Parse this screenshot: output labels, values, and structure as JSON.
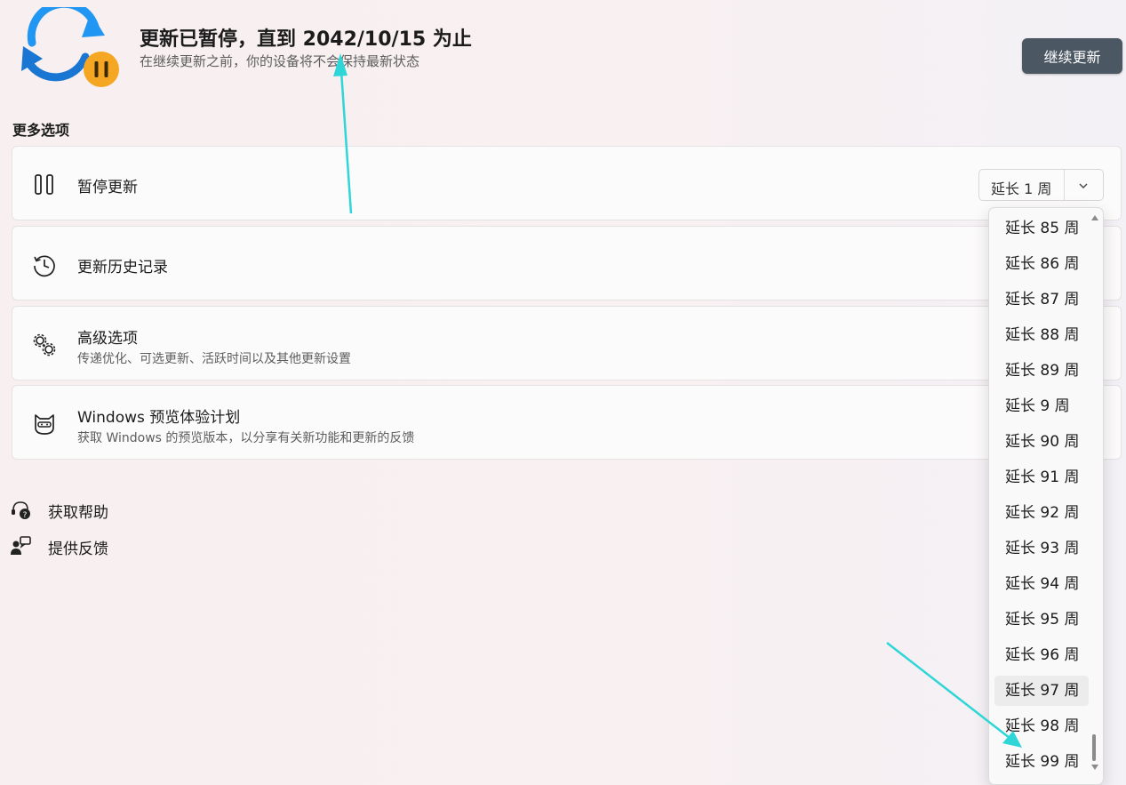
{
  "header": {
    "status_title": "更新已暂停，直到 2042/10/15 为止",
    "status_subtitle": "在继续更新之前，你的设备将不会保持最新状态",
    "resume_button": "继续更新",
    "icon": "sync-paused-icon"
  },
  "more_options": {
    "section_title": "更多选项",
    "pause": {
      "title": "暂停更新",
      "selected": "延长 1 周",
      "icon": "pause-icon"
    },
    "history": {
      "title": "更新历史记录",
      "icon": "history-icon"
    },
    "advanced": {
      "title": "高级选项",
      "desc": "传递优化、可选更新、活跃时间以及其他更新设置",
      "icon": "gears-icon"
    },
    "insider": {
      "title": "Windows 预览体验计划",
      "desc": "获取 Windows 的预览版本，以分享有关新功能和更新的反馈",
      "icon": "ninja-cat-icon"
    }
  },
  "links": {
    "help": "获取帮助",
    "feedback": "提供反馈"
  },
  "dropdown": {
    "options": [
      "延长 85 周",
      "延长 86 周",
      "延长 87 周",
      "延长 88 周",
      "延长 89 周",
      "延长 9 周",
      "延长 90 周",
      "延长 91 周",
      "延长 92 周",
      "延长 93 周",
      "延长 94 周",
      "延长 95 周",
      "延长 96 周",
      "延长 97 周",
      "延长 98 周",
      "延长 99 周"
    ],
    "hovered": "延长 97 周"
  },
  "colors": {
    "accent_blue": "#1e88e5",
    "pause_badge": "#f5a623",
    "button_dark": "#4b5763",
    "annotation_arrow": "#2ed6d8"
  }
}
